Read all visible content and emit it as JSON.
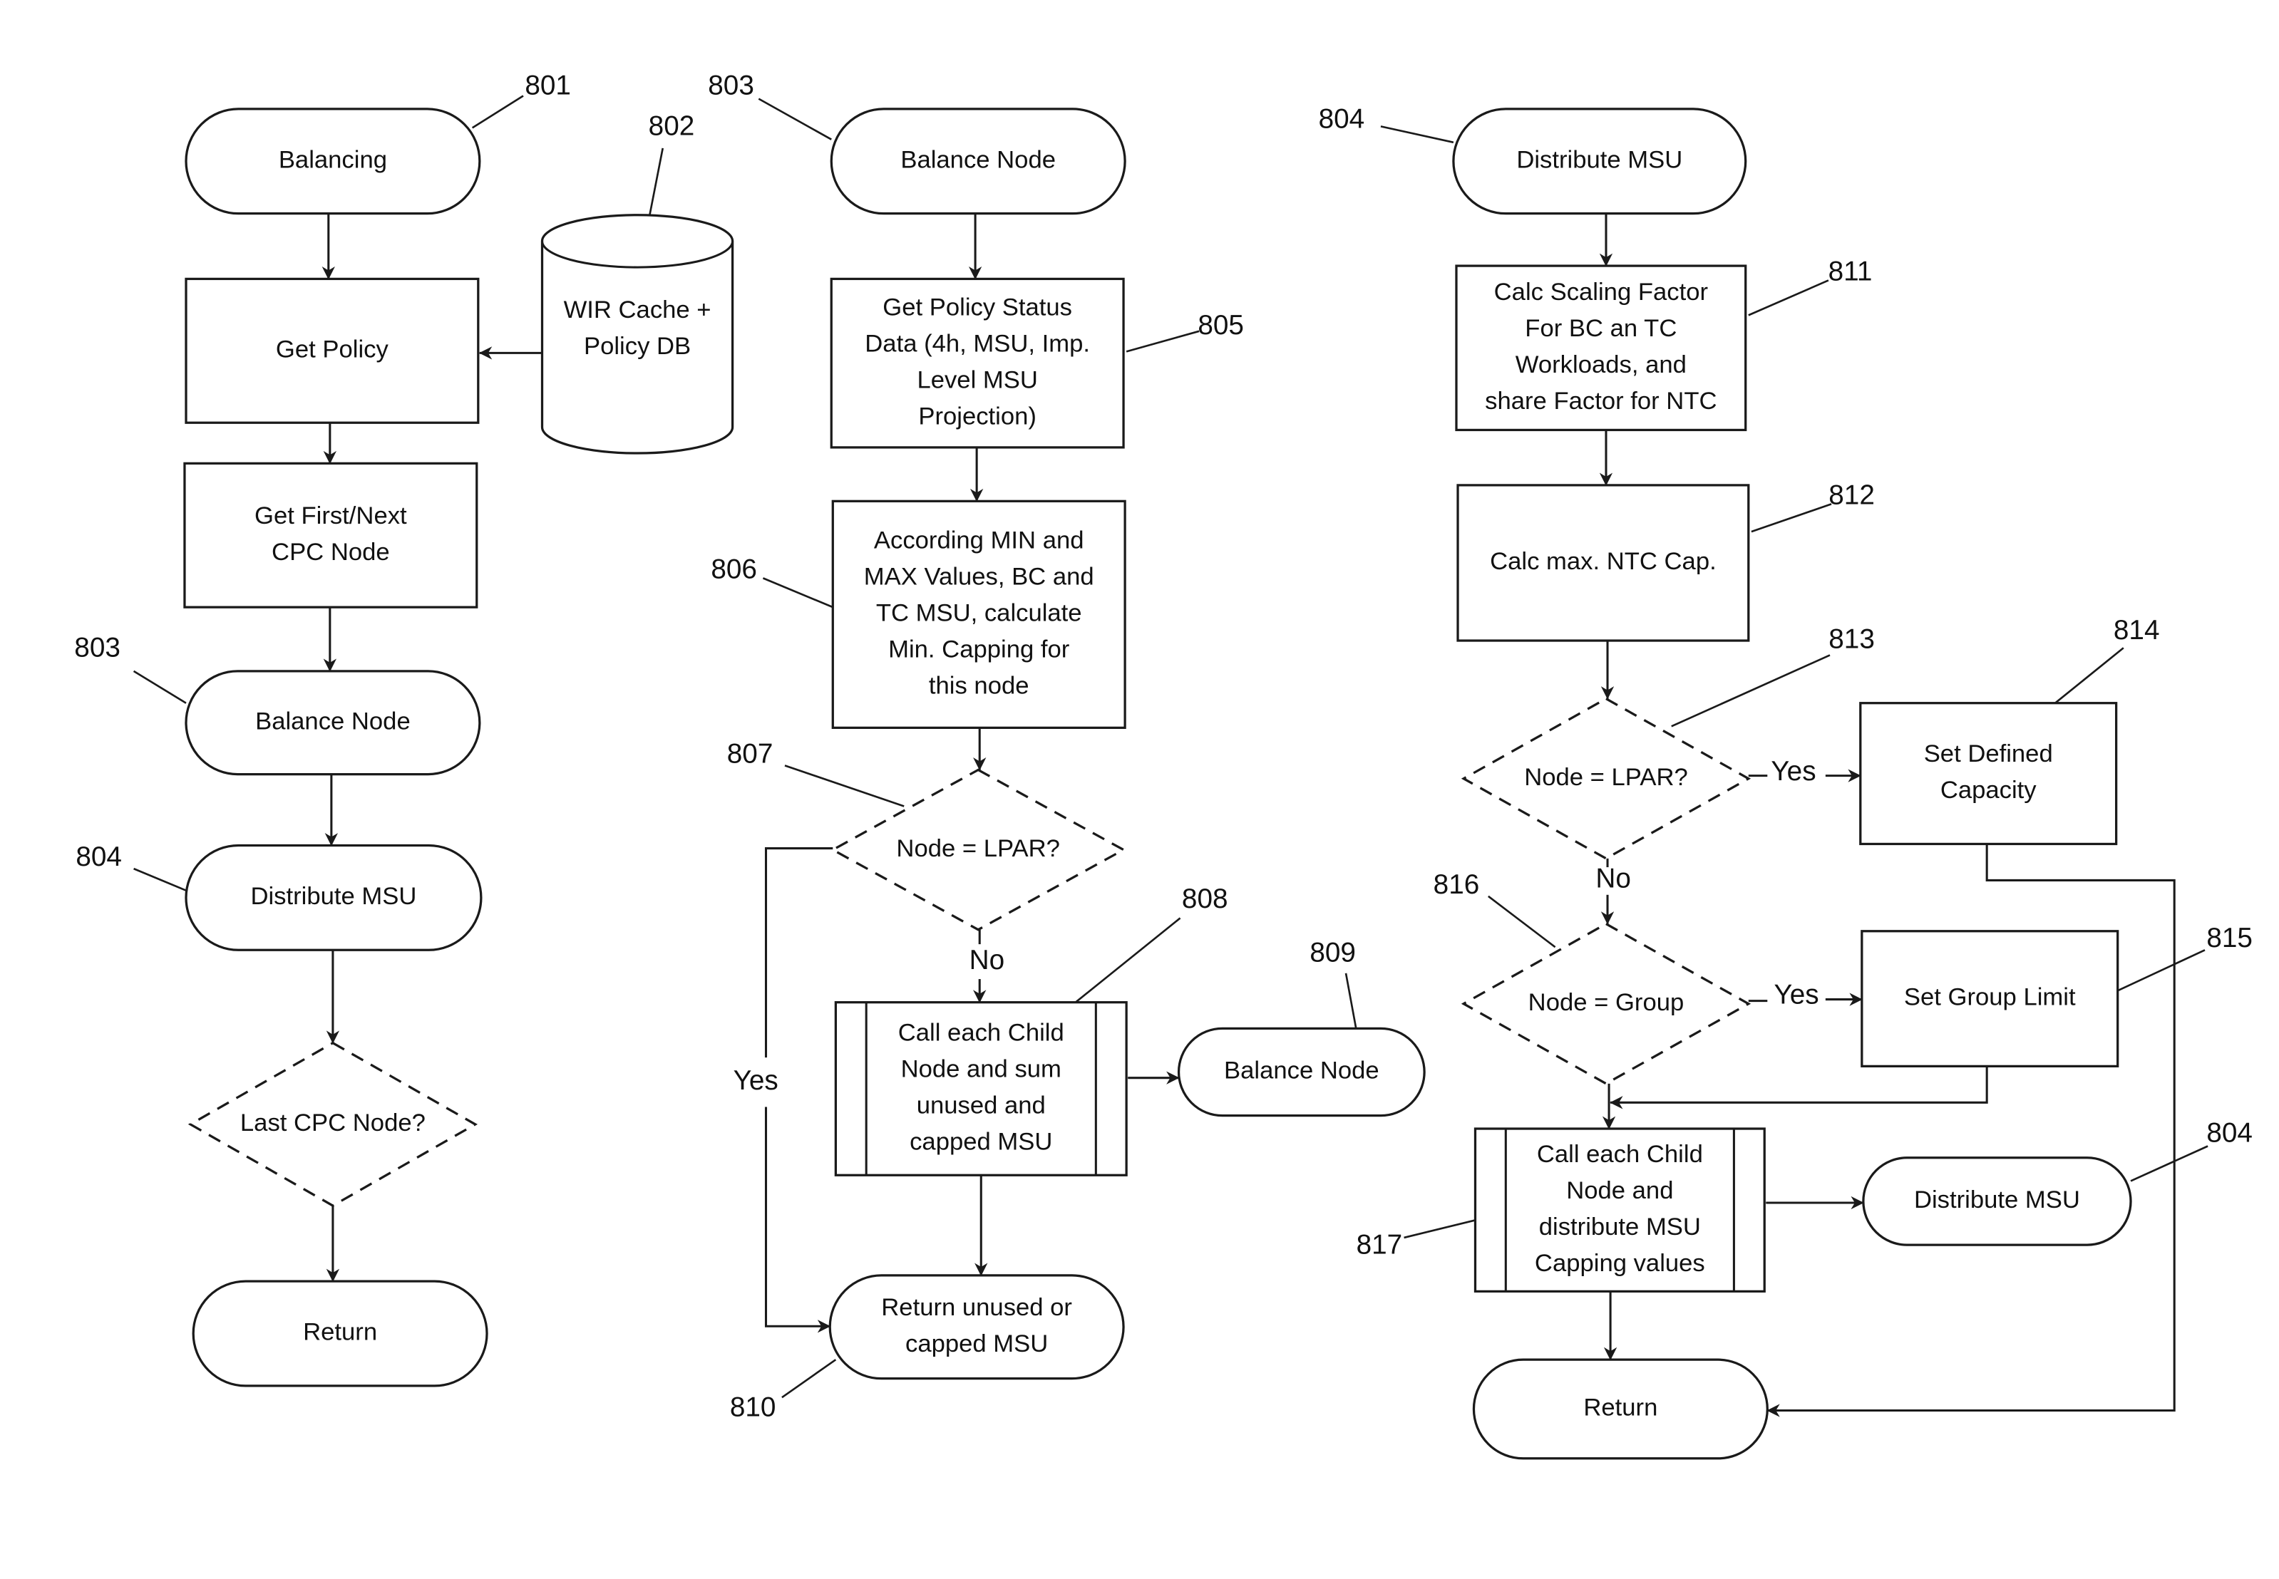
{
  "figure": {
    "type": "flowchart",
    "columns": [
      {
        "id": "balancing-flow",
        "title_node": "n801"
      },
      {
        "id": "balance-node-flow",
        "title_node": "n803b"
      },
      {
        "id": "distribute-msu-flow",
        "title_node": "n804c"
      }
    ]
  },
  "nodes": {
    "n801": {
      "ref": "801",
      "shape": "terminal",
      "lines": [
        "Balancing"
      ]
    },
    "n802": {
      "ref": "802",
      "shape": "database",
      "lines": [
        "WIR Cache +",
        "Policy DB"
      ]
    },
    "nGetPolicy": {
      "ref": "",
      "shape": "process",
      "lines": [
        "Get Policy"
      ]
    },
    "nGetFirst": {
      "ref": "",
      "shape": "process",
      "lines": [
        "Get First/Next",
        "CPC Node"
      ]
    },
    "n803a": {
      "ref": "803",
      "shape": "terminal",
      "lines": [
        "Balance Node"
      ]
    },
    "n804a": {
      "ref": "804",
      "shape": "terminal",
      "lines": [
        "Distribute MSU"
      ]
    },
    "nLast": {
      "ref": "",
      "shape": "decision",
      "lines": [
        "Last CPC Node?"
      ]
    },
    "nRet1": {
      "ref": "",
      "shape": "terminal",
      "lines": [
        "Return"
      ]
    },
    "n803b": {
      "ref": "803",
      "shape": "terminal",
      "lines": [
        "Balance Node"
      ]
    },
    "n805": {
      "ref": "805",
      "shape": "process",
      "lines": [
        "Get Policy Status",
        "Data (4h, MSU, Imp.",
        "Level MSU",
        "Projection)"
      ]
    },
    "n806": {
      "ref": "806",
      "shape": "process",
      "lines": [
        "According MIN and",
        "MAX Values, BC and",
        "TC MSU, calculate",
        "Min. Capping for",
        "this node"
      ]
    },
    "n807": {
      "ref": "807",
      "shape": "decision",
      "lines": [
        "Node = LPAR?"
      ]
    },
    "n808": {
      "ref": "808",
      "shape": "subprocess",
      "lines": [
        "Call each Child",
        "Node and sum",
        "unused and",
        "capped MSU"
      ]
    },
    "n809": {
      "ref": "809",
      "shape": "terminal",
      "lines": [
        "Balance Node"
      ]
    },
    "n810": {
      "ref": "810",
      "shape": "terminal",
      "lines": [
        "Return unused or",
        "capped MSU"
      ]
    },
    "n804c": {
      "ref": "804",
      "shape": "terminal",
      "lines": [
        "Distribute MSU"
      ]
    },
    "n811": {
      "ref": "811",
      "shape": "process",
      "lines": [
        "Calc Scaling Factor",
        "For BC an TC",
        "Workloads, and",
        "share Factor for NTC"
      ]
    },
    "n812": {
      "ref": "812",
      "shape": "process",
      "lines": [
        "Calc max. NTC Cap."
      ]
    },
    "n813": {
      "ref": "813",
      "shape": "decision",
      "lines": [
        "Node = LPAR?"
      ]
    },
    "n814": {
      "ref": "814",
      "shape": "process",
      "lines": [
        "Set Defined",
        "Capacity"
      ]
    },
    "n816": {
      "ref": "816",
      "shape": "decision",
      "lines": [
        "Node = Group"
      ]
    },
    "n815": {
      "ref": "815",
      "shape": "process",
      "lines": [
        "Set Group Limit"
      ]
    },
    "n817": {
      "ref": "817",
      "shape": "subprocess",
      "lines": [
        "Call each Child",
        "Node and",
        "distribute MSU",
        "Capping values"
      ]
    },
    "n804d": {
      "ref": "804",
      "shape": "terminal",
      "lines": [
        "Distribute MSU"
      ]
    },
    "nRet3": {
      "ref": "",
      "shape": "terminal",
      "lines": [
        "Return"
      ]
    }
  },
  "edges": [
    {
      "id": "e1",
      "from": "n801",
      "to": "nGetPolicy",
      "label": ""
    },
    {
      "id": "e2",
      "from": "n802",
      "to": "nGetPolicy",
      "label": ""
    },
    {
      "id": "e3",
      "from": "nGetPolicy",
      "to": "nGetFirst",
      "label": ""
    },
    {
      "id": "e4",
      "from": "nGetFirst",
      "to": "n803a",
      "label": ""
    },
    {
      "id": "e5",
      "from": "n803a",
      "to": "n804a",
      "label": ""
    },
    {
      "id": "e6",
      "from": "n804a",
      "to": "nLast",
      "label": ""
    },
    {
      "id": "e7",
      "from": "nLast",
      "to": "nRet1",
      "label": ""
    },
    {
      "id": "e8",
      "from": "n803b",
      "to": "n805",
      "label": ""
    },
    {
      "id": "e9",
      "from": "n805",
      "to": "n806",
      "label": ""
    },
    {
      "id": "e10",
      "from": "n806",
      "to": "n807",
      "label": ""
    },
    {
      "id": "e11",
      "from": "n807",
      "to": "n808",
      "label": "No"
    },
    {
      "id": "e12",
      "from": "n807",
      "to": "n810",
      "label": "Yes"
    },
    {
      "id": "e13",
      "from": "n808",
      "to": "n809",
      "label": ""
    },
    {
      "id": "e14",
      "from": "n808",
      "to": "n810",
      "label": ""
    },
    {
      "id": "e15",
      "from": "n804c",
      "to": "n811",
      "label": ""
    },
    {
      "id": "e16",
      "from": "n811",
      "to": "n812",
      "label": ""
    },
    {
      "id": "e17",
      "from": "n812",
      "to": "n813",
      "label": ""
    },
    {
      "id": "e18",
      "from": "n813",
      "to": "n814",
      "label": "Yes"
    },
    {
      "id": "e19",
      "from": "n813",
      "to": "n816",
      "label": "No"
    },
    {
      "id": "e20",
      "from": "n816",
      "to": "n815",
      "label": "Yes"
    },
    {
      "id": "e21",
      "from": "n816",
      "to": "n817",
      "label": ""
    },
    {
      "id": "e22",
      "from": "n815",
      "to": "n817",
      "label": ""
    },
    {
      "id": "e23",
      "from": "n817",
      "to": "n804d",
      "label": ""
    },
    {
      "id": "e24",
      "from": "n817",
      "to": "nRet3",
      "label": ""
    },
    {
      "id": "e25",
      "from": "n814",
      "to": "nRet3",
      "label": ""
    }
  ],
  "colors": {
    "stroke": "#1a1a1a",
    "background": "#ffffff",
    "text": "#111111"
  }
}
